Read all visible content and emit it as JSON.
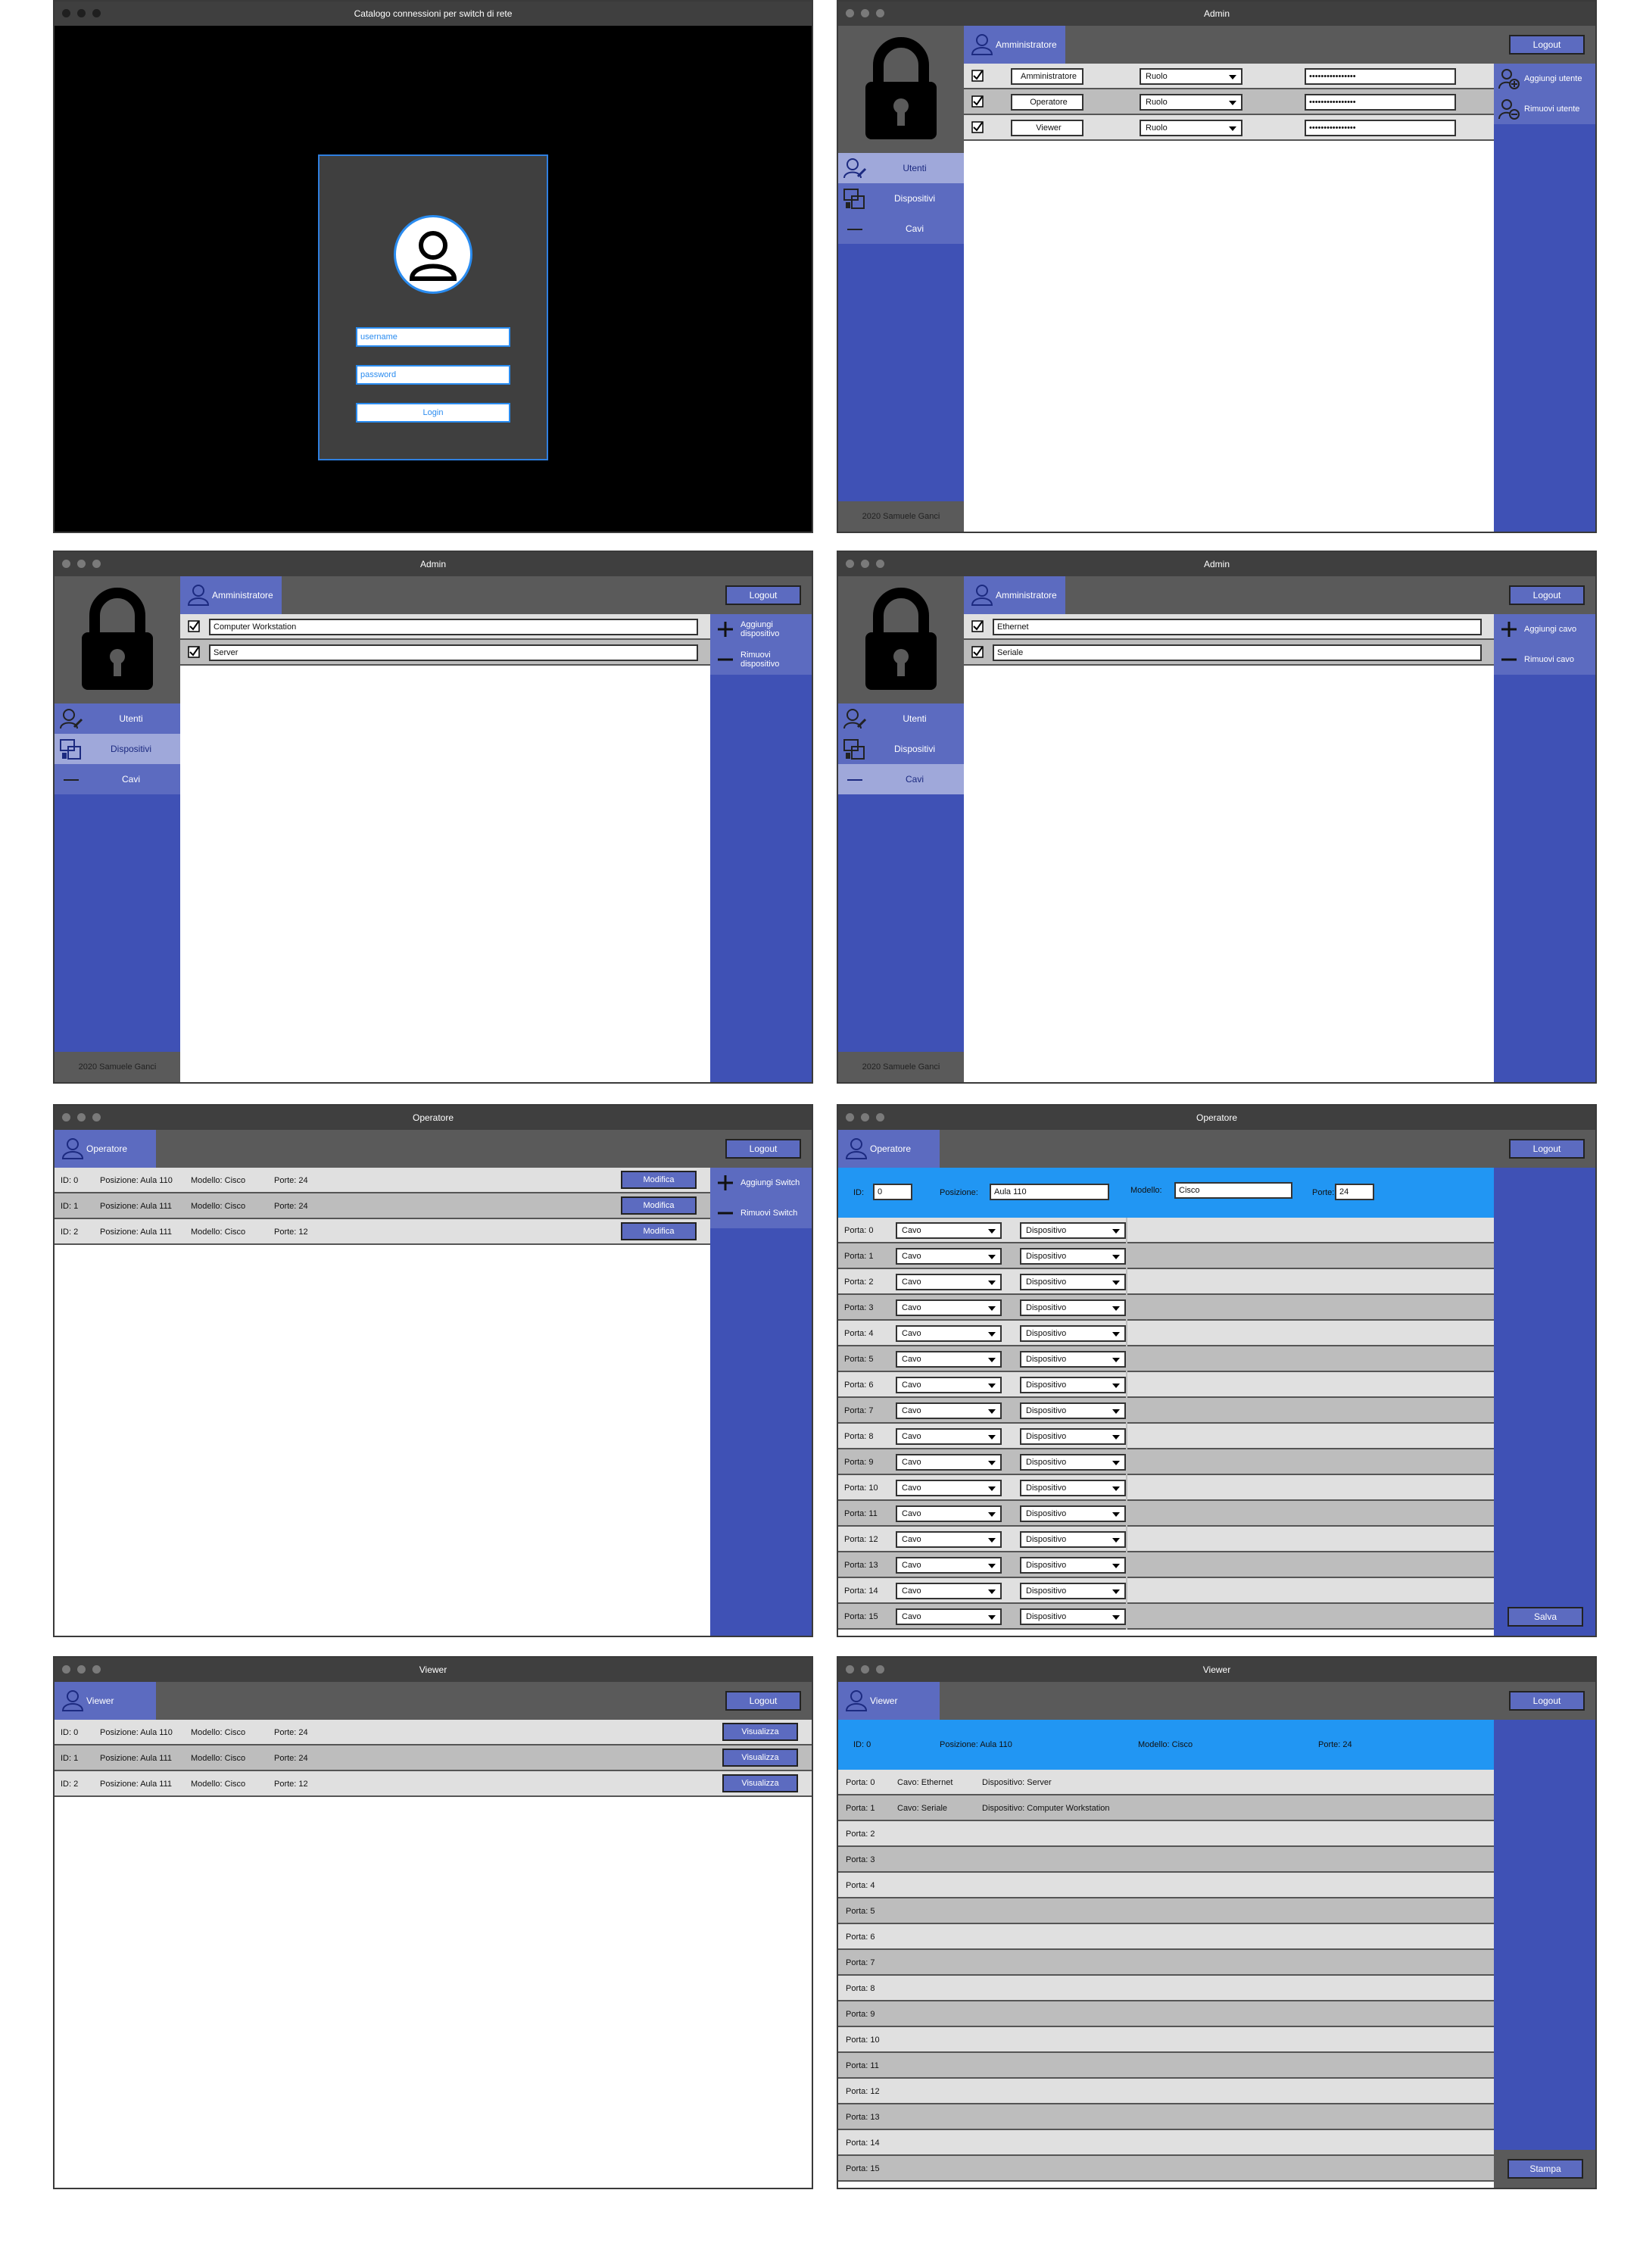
{
  "login": {
    "title": "Catalogo connessioni per switch di rete",
    "username_placeholder": "username",
    "password_placeholder": "password",
    "login_label": "Login"
  },
  "common": {
    "admin_title": "Admin",
    "operatore_title": "Operatore",
    "viewer_title": "Viewer",
    "role_admin": "Amministratore",
    "role_operatore": "Operatore",
    "role_viewer": "Viewer",
    "logout": "Logout",
    "footer": "2020 Samuele Ganci",
    "nav_utenti": "Utenti",
    "nav_dispositivi": "Dispositivi",
    "nav_cavi": "Cavi"
  },
  "users": {
    "rows": [
      {
        "name": "Amministratore",
        "role": "Ruolo",
        "password": "••••••••••••••••"
      },
      {
        "name": "Operatore",
        "role": "Ruolo",
        "password": "••••••••••••••••"
      },
      {
        "name": "Viewer",
        "role": "Ruolo",
        "password": "••••••••••••••••"
      }
    ],
    "add": "Aggiungi utente",
    "remove": "Rimuovi utente"
  },
  "devices": {
    "rows": [
      "Computer Workstation",
      "Server"
    ],
    "add": "Aggiungi dispositivo",
    "remove": "Rimuovi dispositivo"
  },
  "cables": {
    "rows": [
      "Ethernet",
      "Seriale"
    ],
    "add": "Aggiungi cavo",
    "remove": "Rimuovi cavo"
  },
  "switches": {
    "rows": [
      {
        "id": "ID: 0",
        "pos": "Posizione: Aula 110",
        "model": "Modello: Cisco",
        "ports": "Porte: 24"
      },
      {
        "id": "ID: 1",
        "pos": "Posizione: Aula 111",
        "model": "Modello: Cisco",
        "ports": "Porte: 24"
      },
      {
        "id": "ID: 2",
        "pos": "Posizione: Aula 111",
        "model": "Modello: Cisco",
        "ports": "Porte: 12"
      }
    ],
    "edit": "Modifica",
    "view": "Visualizza",
    "add": "Aggiungi Switch",
    "remove": "Rimuovi Switch"
  },
  "editor": {
    "id_label": "ID:",
    "id_value": "0",
    "pos_label": "Posizione:",
    "pos_value": "Aula 110",
    "model_label": "Modello:",
    "model_value": "Cisco",
    "ports_label": "Porte:",
    "ports_value": "24",
    "cable": "Cavo",
    "device": "Dispositivo",
    "save": "Salva",
    "ports": [
      "Porta: 0",
      "Porta: 1",
      "Porta: 2",
      "Porta: 3",
      "Porta: 4",
      "Porta: 5",
      "Porta: 6",
      "Porta: 7",
      "Porta: 8",
      "Porta: 9",
      "Porta: 10",
      "Porta: 11",
      "Porta: 12",
      "Porta: 13",
      "Porta: 14",
      "Porta: 15"
    ]
  },
  "detail": {
    "id": "ID: 0",
    "pos": "Posizione: Aula 110",
    "model": "Modello: Cisco",
    "ports": "Porte: 24",
    "rows": [
      {
        "port": "Porta: 0",
        "cable": "Cavo: Ethernet",
        "device": "Dispositivo: Server"
      },
      {
        "port": "Porta: 1",
        "cable": "Cavo: Seriale",
        "device": "Dispositivo: Computer Workstation"
      },
      {
        "port": "Porta: 2",
        "cable": "",
        "device": ""
      },
      {
        "port": "Porta: 3",
        "cable": "",
        "device": ""
      },
      {
        "port": "Porta: 4",
        "cable": "",
        "device": ""
      },
      {
        "port": "Porta: 5",
        "cable": "",
        "device": ""
      },
      {
        "port": "Porta: 6",
        "cable": "",
        "device": ""
      },
      {
        "port": "Porta: 7",
        "cable": "",
        "device": ""
      },
      {
        "port": "Porta: 8",
        "cable": "",
        "device": ""
      },
      {
        "port": "Porta: 9",
        "cable": "",
        "device": ""
      },
      {
        "port": "Porta: 10",
        "cable": "",
        "device": ""
      },
      {
        "port": "Porta: 11",
        "cable": "",
        "device": ""
      },
      {
        "port": "Porta: 12",
        "cable": "",
        "device": ""
      },
      {
        "port": "Porta: 13",
        "cable": "",
        "device": ""
      },
      {
        "port": "Porta: 14",
        "cable": "",
        "device": ""
      },
      {
        "port": "Porta: 15",
        "cable": "",
        "device": ""
      }
    ],
    "print": "Stampa"
  },
  "colors": {
    "accent": "#3f51b5",
    "accent_light": "#5c6bc0",
    "info": "#2196f3",
    "toolbar": "#5a5a5a"
  }
}
